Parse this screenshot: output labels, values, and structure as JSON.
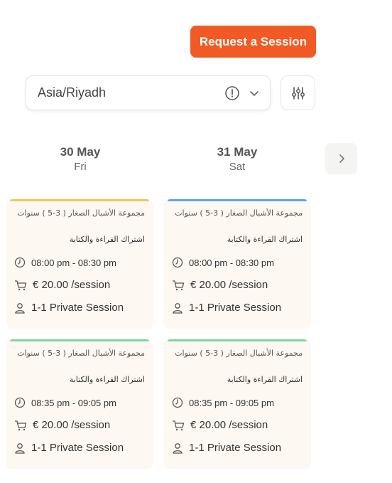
{
  "header": {
    "request_button": "Request a Session"
  },
  "timezone": {
    "value": "Asia/Riyadh"
  },
  "days": [
    {
      "date": "30 May",
      "weekday": "Fri"
    },
    {
      "date": "31 May",
      "weekday": "Sat"
    }
  ],
  "colors": {
    "accent": "#f15a24",
    "bar_yellow": "#f5c45a",
    "bar_blue": "#5aa7f0",
    "bar_green": "#7ed6a0",
    "card_bg": "#fdf8f1"
  },
  "sessions": [
    {
      "title": "مجموعة الأشبال الصغار ( 3-5 ) سنوات",
      "subtitle": "اشتراك القراءة والكتابة",
      "time": "08:00 pm - 08:30 pm",
      "price": "€ 20.00 /session",
      "type": "1-1 Private Session"
    },
    {
      "title": "مجموعة الأشبال الصغار ( 3-5 ) سنوات",
      "subtitle": "اشتراك القراءة والكتابة",
      "time": "08:00 pm - 08:30 pm",
      "price": "€ 20.00 /session",
      "type": "1-1 Private Session"
    },
    {
      "title": "مجموعة الأشبال الصغار ( 3-5 ) سنوات",
      "subtitle": "اشتراك القراءة والكتابة",
      "time": "08:35 pm - 09:05 pm",
      "price": "€ 20.00 /session",
      "type": "1-1 Private Session"
    },
    {
      "title": "مجموعة الأشبال الصغار ( 3-5 ) سنوات",
      "subtitle": "اشتراك القراءة والكتابة",
      "time": "08:35 pm - 09:05 pm",
      "price": "€ 20.00 /session",
      "type": "1-1 Private Session"
    }
  ],
  "icons": [
    "info-icon",
    "chevron-down-icon",
    "filter-sliders-icon",
    "chevron-right-icon",
    "clock-icon",
    "cart-icon",
    "user-icon"
  ]
}
